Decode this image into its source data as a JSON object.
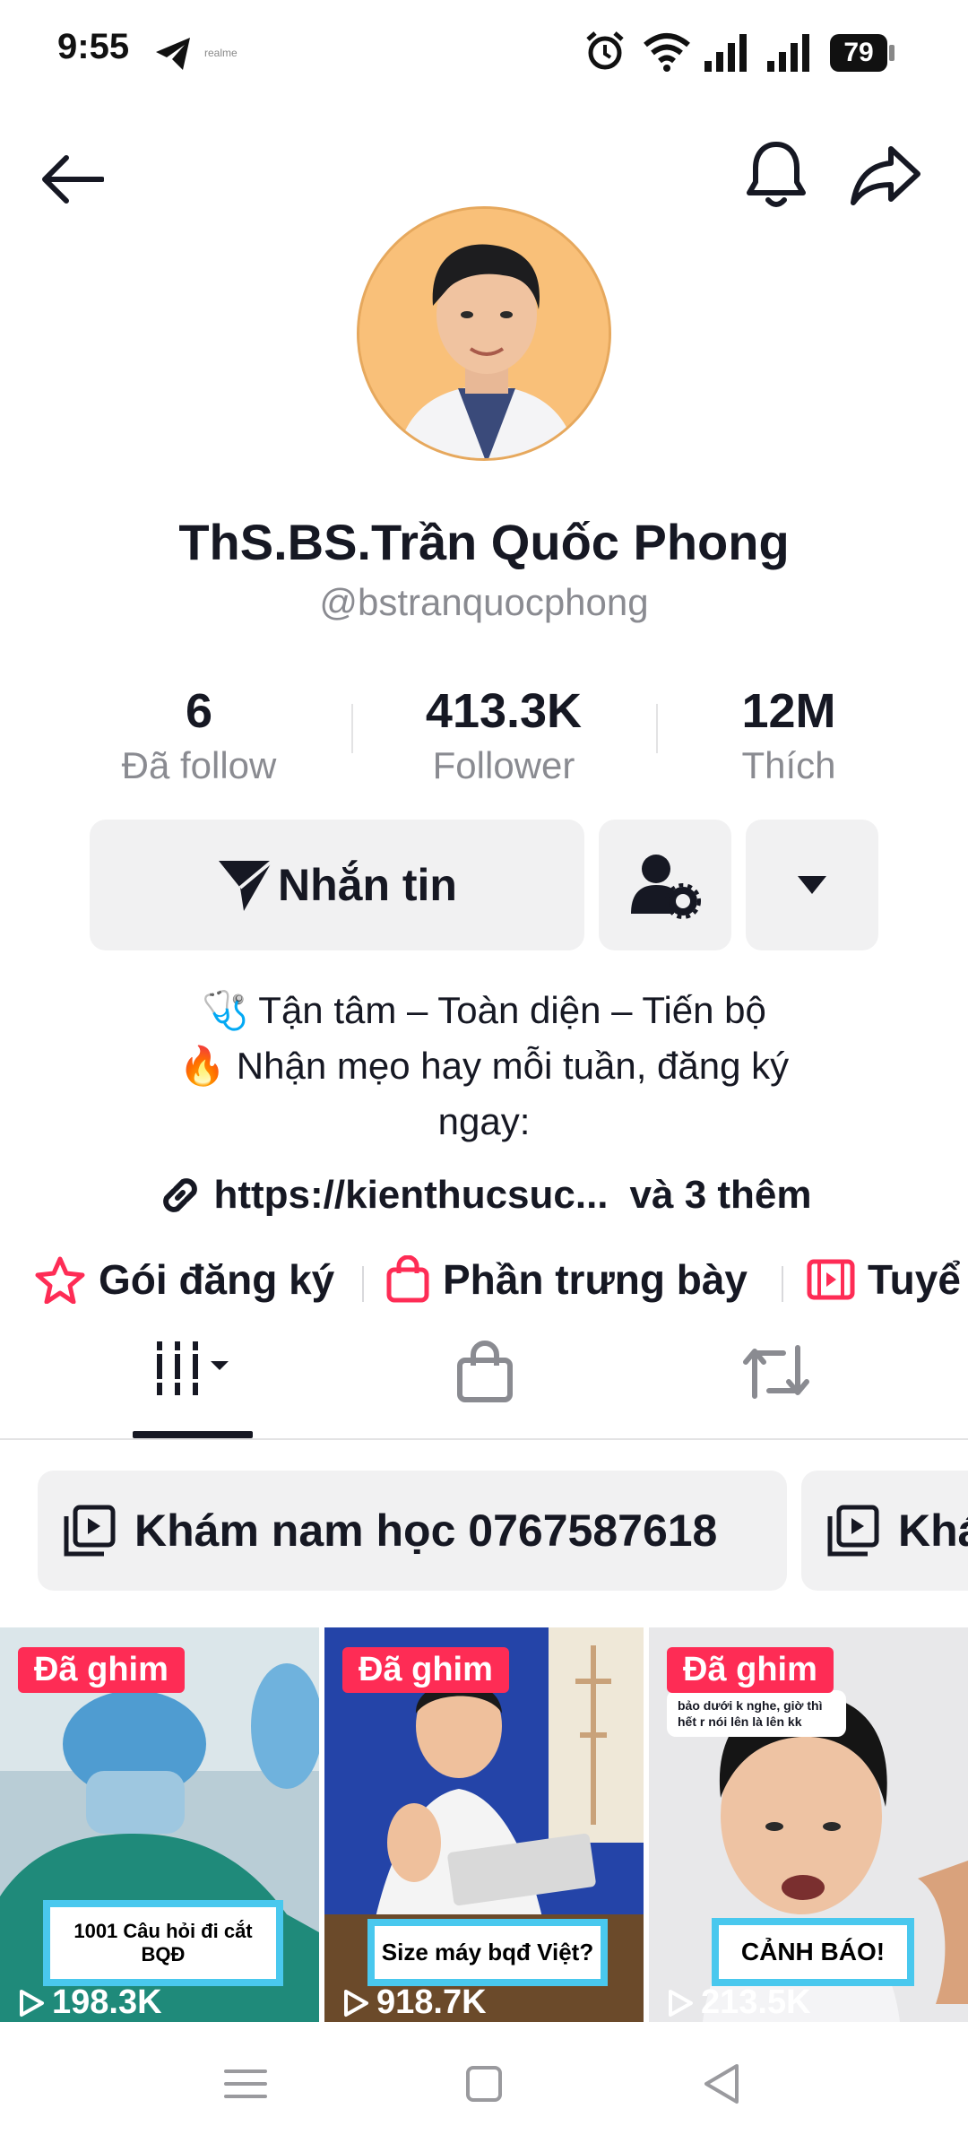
{
  "status_bar": {
    "time": "9:55",
    "notification_text": "realme",
    "battery": "79",
    "icons": [
      "telegram-icon",
      "alarm-icon",
      "wifi-icon",
      "signal-icon",
      "signal-icon",
      "battery-icon"
    ]
  },
  "header": {
    "back_icon": "arrow-left-icon",
    "bell_icon": "bell-icon",
    "share_icon": "share-arrow-icon"
  },
  "profile": {
    "name": "ThS.BS.Trần Quốc Phong",
    "handle": "@bstranquocphong",
    "avatar_bg": "#f9c079"
  },
  "stats": [
    {
      "value": "6",
      "label": "Đã follow"
    },
    {
      "value": "413.3K",
      "label": "Follower"
    },
    {
      "value": "12M",
      "label": "Thích"
    }
  ],
  "actions": {
    "message_label": "Nhắn tin",
    "message_icon": "send-icon",
    "user_settings_icon": "user-gear-icon",
    "dropdown_icon": "caret-down-icon"
  },
  "bio": {
    "line1": "🩺 Tận tâm – Toàn diện – Tiến bộ",
    "line2": "🔥 Nhận mẹo hay mỗi tuần, đăng ký",
    "line3": "ngay:",
    "link_text": "https://kienthucsuc...",
    "link_more": "và 3 thêm"
  },
  "feature_tabs": [
    {
      "label": "Gói đăng ký",
      "icon": "star-icon"
    },
    {
      "label": "Phần trưng bày",
      "icon": "shopping-bag-icon"
    },
    {
      "label": "Tuyể",
      "icon": "film-icon"
    }
  ],
  "content_tabs": {
    "videos_icon": "grid-icon",
    "shop_icon": "bag-icon",
    "repost_icon": "repost-icon"
  },
  "playlists": [
    {
      "label": "Khám nam học 0767587618"
    },
    {
      "label": "Khá"
    }
  ],
  "videos": [
    {
      "badge": "Đã ghim",
      "caption": "1001 Câu hỏi đi cắt BQĐ",
      "views": "198.3K"
    },
    {
      "badge": "Đã ghim",
      "caption": "Size máy bqđ Việt?",
      "views": "918.7K",
      "notice": ""
    },
    {
      "badge": "Đã ghim",
      "caption": "CẢNH BÁO!",
      "views": "213.5K",
      "comment_bubble": "bảo dưới k nghe, giờ thì hết r nói lên là lên kk"
    }
  ],
  "colors": {
    "accent": "#fe2c55",
    "muted": "#8a8b91",
    "button_bg": "#f1f1f2"
  }
}
